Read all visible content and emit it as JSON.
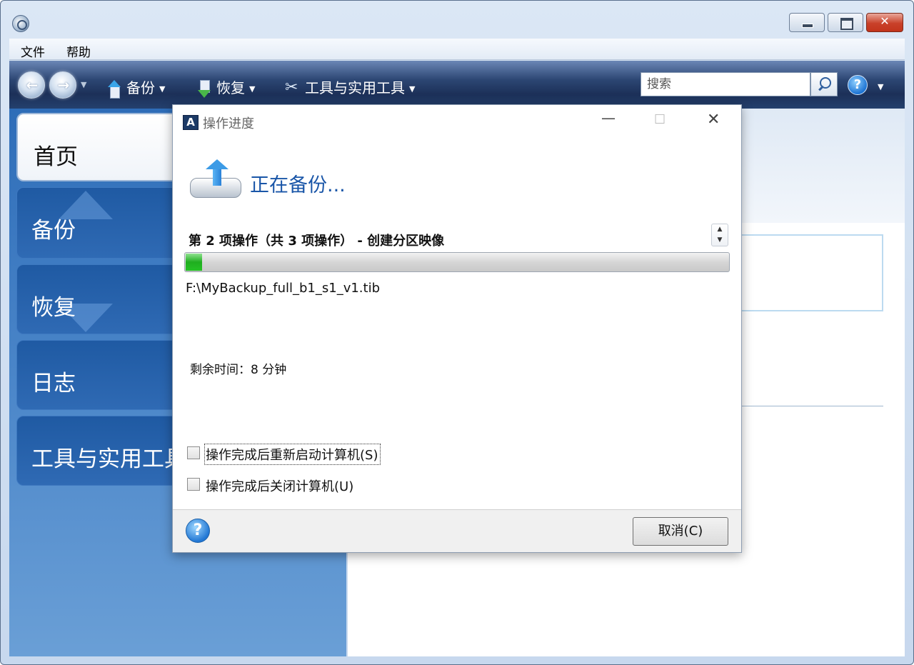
{
  "menu": {
    "file": "文件",
    "help": "帮助"
  },
  "toolbar": {
    "backup": "备份",
    "restore": "恢复",
    "tools": "工具与实用工具",
    "search_placeholder": "搜索"
  },
  "nav": {
    "home": "首页",
    "backup": "备份",
    "restore": "恢复",
    "log": "日志",
    "tools": "工具与实用工具"
  },
  "dialog": {
    "title": "操作进度",
    "heading": "正在备份...",
    "operation": "第 2 项操作（共 3 项操作） - 创建分区映像",
    "progress_fraction": 0.03,
    "file": "F:\\MyBackup_full_b1_s1_v1.tib",
    "time_remaining": "剩余时间：8 分钟",
    "restart_label": "操作完成后重新启动计算机(S)",
    "shutdown_label": "操作完成后关闭计算机(U)",
    "cancel_label": "取消(C)"
  },
  "colors": {
    "accent": "#1a56a8",
    "progress": "#1fae1f",
    "nav_background": "#2e6db8"
  }
}
